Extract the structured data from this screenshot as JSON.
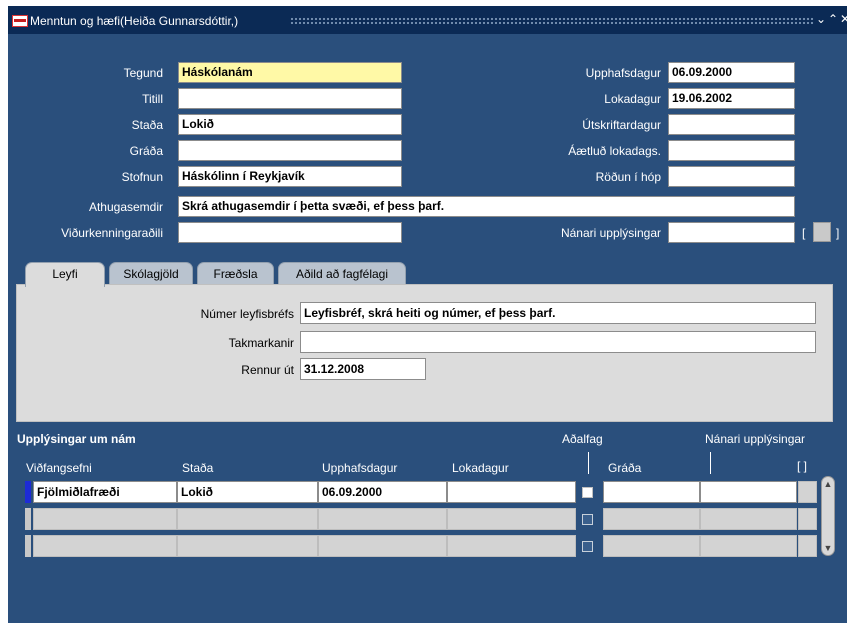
{
  "window": {
    "title": "Menntun og hæfi(Heiða Gunnarsdóttir,)",
    "controls": {
      "minimize": "⌄",
      "restore": "⌃",
      "close": "✕"
    }
  },
  "form": {
    "tegund": {
      "label": "Tegund",
      "value": "Háskólanám"
    },
    "titill": {
      "label": "Titill",
      "value": ""
    },
    "stada": {
      "label": "Staða",
      "value": "Lokið"
    },
    "grada": {
      "label": "Gráða",
      "value": ""
    },
    "stofnun": {
      "label": "Stofnun",
      "value": "Háskólinn í Reykjavík"
    },
    "athugasemdir": {
      "label": "Athugasemdir",
      "value": "Skrá athugasemdir í þetta svæði, ef þess þarf."
    },
    "vidurkenningaradili": {
      "label": "Viðurkenningaraðili",
      "value": ""
    },
    "upphafsdagur": {
      "label": "Upphafsdagur",
      "value": "06.09.2000"
    },
    "lokadagur": {
      "label": "Lokadagur",
      "value": "19.06.2002"
    },
    "utskriftardagur": {
      "label": "Útskriftardagur",
      "value": ""
    },
    "aetlud_lokadags": {
      "label": "Áætluð lokadags.",
      "value": ""
    },
    "rodun_i_hop": {
      "label": "Röðun í hóp",
      "value": ""
    },
    "nanari_upplysingar": {
      "label": "Nánari upplýsingar",
      "value": ""
    },
    "bracket_open": "[",
    "bracket_close": "]"
  },
  "tabs": [
    {
      "label": "Leyfi",
      "active": true
    },
    {
      "label": "Skólagjöld",
      "active": false
    },
    {
      "label": "Fræðsla",
      "active": false
    },
    {
      "label": "Aðild að fagfélagi",
      "active": false
    }
  ],
  "leyfi": {
    "numer": {
      "label": "Númer leyfisbréfs",
      "value": "Leyfisbréf, skrá heiti og númer, ef þess þarf."
    },
    "takmarkanir": {
      "label": "Takmarkanir",
      "value": ""
    },
    "rennur_ut": {
      "label": "Rennur út",
      "value": "31.12.2008"
    }
  },
  "nam_table": {
    "title": "Upplýsingar um nám",
    "headers": {
      "vidfangsefni": "Viðfangsefni",
      "stada": "Staða",
      "upphafsdagur": "Upphafsdagur",
      "lokadagur": "Lokadagur",
      "adalfag": "Aðalfag",
      "grada": "Gráða",
      "nanari": "Nánari upplýsingar",
      "brackets": "[ ]"
    },
    "rows": [
      {
        "vidfangsefni": "Fjölmiðlafræði",
        "stada": "Lokið",
        "upphafsdagur": "06.09.2000",
        "lokadagur": "",
        "grada": "",
        "nanari": ""
      },
      {
        "vidfangsefni": "",
        "stada": "",
        "upphafsdagur": "",
        "lokadagur": "",
        "grada": "",
        "nanari": ""
      },
      {
        "vidfangsefni": "",
        "stada": "",
        "upphafsdagur": "",
        "lokadagur": "",
        "grada": "",
        "nanari": ""
      }
    ]
  },
  "colors": {
    "window_bg": "#2a4f7c",
    "titlebar_bg": "#0b2a55",
    "required_field": "#fff9a6",
    "tab_panel": "#dcdcdc",
    "row_indicator": "#1d2bd6"
  }
}
